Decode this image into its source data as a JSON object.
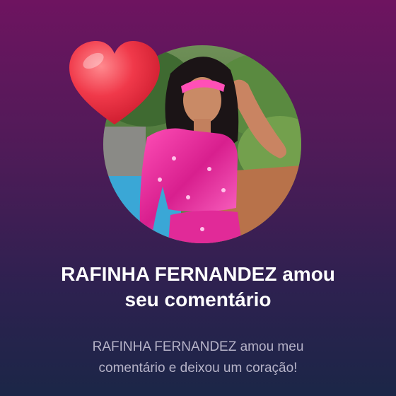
{
  "notification": {
    "user_name": "RAFINHA FERNANDEZ",
    "title_suffix_line1": "amou",
    "title_line2": "seu comentário",
    "subtitle_line1": "RAFINHA FERNANDEZ amou meu",
    "subtitle_line2": "comentário e deixou um coração!"
  },
  "icons": {
    "reaction": "heart-icon"
  },
  "colors": {
    "heart": "#f0394a",
    "background_top": "#6e1460",
    "background_bottom": "#1b2647"
  }
}
